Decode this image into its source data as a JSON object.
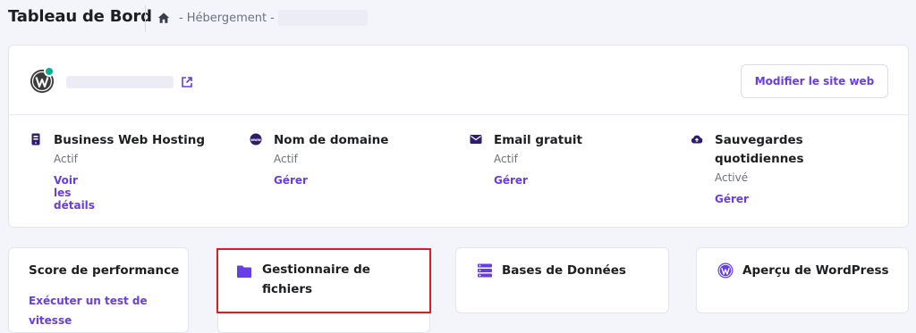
{
  "header": {
    "title": "Tableau de Bord",
    "breadcrumb": {
      "sep1": "-",
      "item": "Hébergement",
      "sep2": "-"
    }
  },
  "site_card": {
    "modify_button": "Modifier le site web",
    "services": [
      {
        "title": "Business Web Hosting",
        "status": "Actif",
        "link": "Voir les détails",
        "icon": "server-icon"
      },
      {
        "title": "Nom de domaine",
        "status": "Actif",
        "link": "Gérer",
        "icon": "www-icon"
      },
      {
        "title": "Email gratuit",
        "status": "Actif",
        "link": "Gérer",
        "icon": "mail-icon"
      },
      {
        "title_line1": "Sauvegardes",
        "title_line2": "quotidiennes",
        "status": "Activé",
        "link": "Gérer",
        "icon": "cloud-upload-icon"
      }
    ]
  },
  "tiles": {
    "performance": {
      "title": "Score de performance",
      "link_line1": "Exécuter un test de",
      "link_line2": "vitesse"
    },
    "file_manager": {
      "title_line1": "Gestionnaire de",
      "title_line2": "fichiers",
      "icon": "folder-icon"
    },
    "databases": {
      "title": "Bases de Données",
      "icon": "database-icon"
    },
    "wordpress": {
      "title": "Aperçu de WordPress",
      "icon": "wordpress-icon"
    }
  },
  "colors": {
    "accent": "#673de6",
    "status_dot": "#00b090",
    "highlight": "#e01b24",
    "background": "#f4f4fb"
  }
}
